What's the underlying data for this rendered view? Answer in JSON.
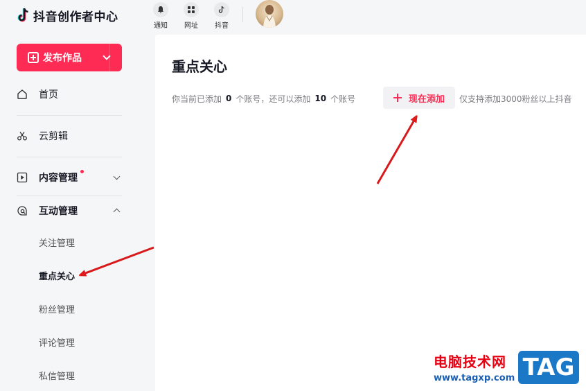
{
  "app": {
    "name": "抖音创作者中心",
    "icons": {
      "logo": "douyin-note-icon"
    }
  },
  "sidebar": {
    "publish_label": "发布作品",
    "items": [
      {
        "label": "首页",
        "icon": "home-icon"
      },
      {
        "label": "云剪辑",
        "icon": "scissors-icon"
      },
      {
        "label": "内容管理",
        "icon": "play-square-icon",
        "has_dot": true,
        "expanded": false
      },
      {
        "label": "互动管理",
        "icon": "chat-search-icon",
        "expanded": true
      }
    ],
    "sub_items": [
      {
        "label": "关注管理",
        "active": false
      },
      {
        "label": "重点关心",
        "active": true
      },
      {
        "label": "粉丝管理",
        "active": false
      },
      {
        "label": "评论管理",
        "active": false
      },
      {
        "label": "私信管理",
        "active": false
      }
    ],
    "colors": {
      "accent": "#fe2c55"
    }
  },
  "topbar": {
    "buttons": [
      {
        "label": "通知",
        "icon": "bell-icon"
      },
      {
        "label": "网址",
        "icon": "grid-icon"
      },
      {
        "label": "抖音",
        "icon": "douyin-icon"
      }
    ]
  },
  "main": {
    "title": "重点关心",
    "info_prefix": "你当前已添加",
    "added_count": "0",
    "info_middle": "个账号，还可以添加",
    "remaining_count": "10",
    "info_suffix": "个账号",
    "add_button_label": "现在添加",
    "hint": "仅支持添加3000粉丝以上抖音"
  },
  "watermark": {
    "site_name": "电脑技术网",
    "url": "www.tagxp.com",
    "badge": "TAG"
  }
}
